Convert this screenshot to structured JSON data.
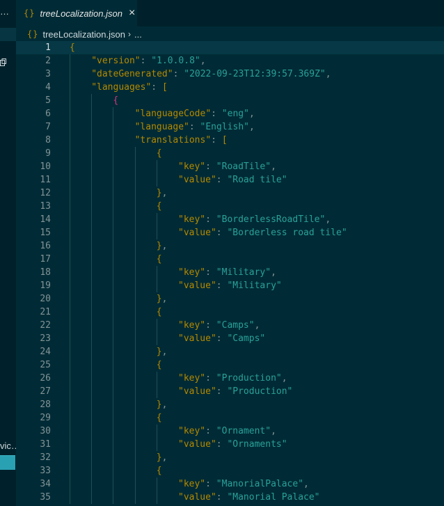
{
  "sidebar": {
    "ellipsis": "…",
    "fragment_text": "vic…"
  },
  "tab": {
    "icon": "{}",
    "title": "treeLocalization.json",
    "close": "×"
  },
  "breadcrumb": {
    "icon": "{}",
    "file": "treeLocalization.json",
    "separator": "›",
    "more": "..."
  },
  "editor": {
    "current_line": 1,
    "lines": [
      {
        "n": "1",
        "indent": 0,
        "tokens": [
          [
            "b1",
            "{"
          ]
        ]
      },
      {
        "n": "2",
        "indent": 1,
        "tokens": [
          [
            "k",
            "\"version\""
          ],
          [
            "p",
            ": "
          ],
          [
            "s",
            "\"1.0.0.8\""
          ],
          [
            "p",
            ","
          ]
        ]
      },
      {
        "n": "3",
        "indent": 1,
        "tokens": [
          [
            "k",
            "\"dateGenerated\""
          ],
          [
            "p",
            ": "
          ],
          [
            "s",
            "\"2022-09-23T12:39:57.369Z\""
          ],
          [
            "p",
            ","
          ]
        ]
      },
      {
        "n": "4",
        "indent": 1,
        "tokens": [
          [
            "k",
            "\"languages\""
          ],
          [
            "p",
            ": "
          ],
          [
            "b1",
            "["
          ]
        ]
      },
      {
        "n": "5",
        "indent": 2,
        "tokens": [
          [
            "b2",
            "{"
          ]
        ]
      },
      {
        "n": "6",
        "indent": 3,
        "tokens": [
          [
            "k",
            "\"languageCode\""
          ],
          [
            "p",
            ": "
          ],
          [
            "s",
            "\"eng\""
          ],
          [
            "p",
            ","
          ]
        ]
      },
      {
        "n": "7",
        "indent": 3,
        "tokens": [
          [
            "k",
            "\"language\""
          ],
          [
            "p",
            ": "
          ],
          [
            "s",
            "\"English\""
          ],
          [
            "p",
            ","
          ]
        ]
      },
      {
        "n": "8",
        "indent": 3,
        "tokens": [
          [
            "k",
            "\"translations\""
          ],
          [
            "p",
            ": "
          ],
          [
            "b1",
            "["
          ]
        ]
      },
      {
        "n": "9",
        "indent": 4,
        "tokens": [
          [
            "b1",
            "{"
          ]
        ]
      },
      {
        "n": "10",
        "indent": 5,
        "tokens": [
          [
            "k",
            "\"key\""
          ],
          [
            "p",
            ": "
          ],
          [
            "s",
            "\"RoadTile\""
          ],
          [
            "p",
            ","
          ]
        ]
      },
      {
        "n": "11",
        "indent": 5,
        "tokens": [
          [
            "k",
            "\"value\""
          ],
          [
            "p",
            ": "
          ],
          [
            "s",
            "\"Road tile\""
          ]
        ]
      },
      {
        "n": "12",
        "indent": 4,
        "tokens": [
          [
            "b1",
            "}"
          ],
          [
            "p",
            ","
          ]
        ]
      },
      {
        "n": "13",
        "indent": 4,
        "tokens": [
          [
            "b1",
            "{"
          ]
        ]
      },
      {
        "n": "14",
        "indent": 5,
        "tokens": [
          [
            "k",
            "\"key\""
          ],
          [
            "p",
            ": "
          ],
          [
            "s",
            "\"BorderlessRoadTile\""
          ],
          [
            "p",
            ","
          ]
        ]
      },
      {
        "n": "15",
        "indent": 5,
        "tokens": [
          [
            "k",
            "\"value\""
          ],
          [
            "p",
            ": "
          ],
          [
            "s",
            "\"Borderless road tile\""
          ]
        ]
      },
      {
        "n": "16",
        "indent": 4,
        "tokens": [
          [
            "b1",
            "}"
          ],
          [
            "p",
            ","
          ]
        ]
      },
      {
        "n": "17",
        "indent": 4,
        "tokens": [
          [
            "b1",
            "{"
          ]
        ]
      },
      {
        "n": "18",
        "indent": 5,
        "tokens": [
          [
            "k",
            "\"key\""
          ],
          [
            "p",
            ": "
          ],
          [
            "s",
            "\"Military\""
          ],
          [
            "p",
            ","
          ]
        ]
      },
      {
        "n": "19",
        "indent": 5,
        "tokens": [
          [
            "k",
            "\"value\""
          ],
          [
            "p",
            ": "
          ],
          [
            "s",
            "\"Military\""
          ]
        ]
      },
      {
        "n": "20",
        "indent": 4,
        "tokens": [
          [
            "b1",
            "}"
          ],
          [
            "p",
            ","
          ]
        ]
      },
      {
        "n": "21",
        "indent": 4,
        "tokens": [
          [
            "b1",
            "{"
          ]
        ]
      },
      {
        "n": "22",
        "indent": 5,
        "tokens": [
          [
            "k",
            "\"key\""
          ],
          [
            "p",
            ": "
          ],
          [
            "s",
            "\"Camps\""
          ],
          [
            "p",
            ","
          ]
        ]
      },
      {
        "n": "23",
        "indent": 5,
        "tokens": [
          [
            "k",
            "\"value\""
          ],
          [
            "p",
            ": "
          ],
          [
            "s",
            "\"Camps\""
          ]
        ]
      },
      {
        "n": "24",
        "indent": 4,
        "tokens": [
          [
            "b1",
            "}"
          ],
          [
            "p",
            ","
          ]
        ]
      },
      {
        "n": "25",
        "indent": 4,
        "tokens": [
          [
            "b1",
            "{"
          ]
        ]
      },
      {
        "n": "26",
        "indent": 5,
        "tokens": [
          [
            "k",
            "\"key\""
          ],
          [
            "p",
            ": "
          ],
          [
            "s",
            "\"Production\""
          ],
          [
            "p",
            ","
          ]
        ]
      },
      {
        "n": "27",
        "indent": 5,
        "tokens": [
          [
            "k",
            "\"value\""
          ],
          [
            "p",
            ": "
          ],
          [
            "s",
            "\"Production\""
          ]
        ]
      },
      {
        "n": "28",
        "indent": 4,
        "tokens": [
          [
            "b1",
            "}"
          ],
          [
            "p",
            ","
          ]
        ]
      },
      {
        "n": "29",
        "indent": 4,
        "tokens": [
          [
            "b1",
            "{"
          ]
        ]
      },
      {
        "n": "30",
        "indent": 5,
        "tokens": [
          [
            "k",
            "\"key\""
          ],
          [
            "p",
            ": "
          ],
          [
            "s",
            "\"Ornament\""
          ],
          [
            "p",
            ","
          ]
        ]
      },
      {
        "n": "31",
        "indent": 5,
        "tokens": [
          [
            "k",
            "\"value\""
          ],
          [
            "p",
            ": "
          ],
          [
            "s",
            "\"Ornaments\""
          ]
        ]
      },
      {
        "n": "32",
        "indent": 4,
        "tokens": [
          [
            "b1",
            "}"
          ],
          [
            "p",
            ","
          ]
        ]
      },
      {
        "n": "33",
        "indent": 4,
        "tokens": [
          [
            "b1",
            "{"
          ]
        ]
      },
      {
        "n": "34",
        "indent": 5,
        "tokens": [
          [
            "k",
            "\"key\""
          ],
          [
            "p",
            ": "
          ],
          [
            "s",
            "\"ManorialPalace\""
          ],
          [
            "p",
            ","
          ]
        ]
      },
      {
        "n": "35",
        "indent": 5,
        "tokens": [
          [
            "k",
            "\"value\""
          ],
          [
            "p",
            ": "
          ],
          [
            "s",
            "\"Manorial Palace\""
          ]
        ]
      }
    ]
  }
}
